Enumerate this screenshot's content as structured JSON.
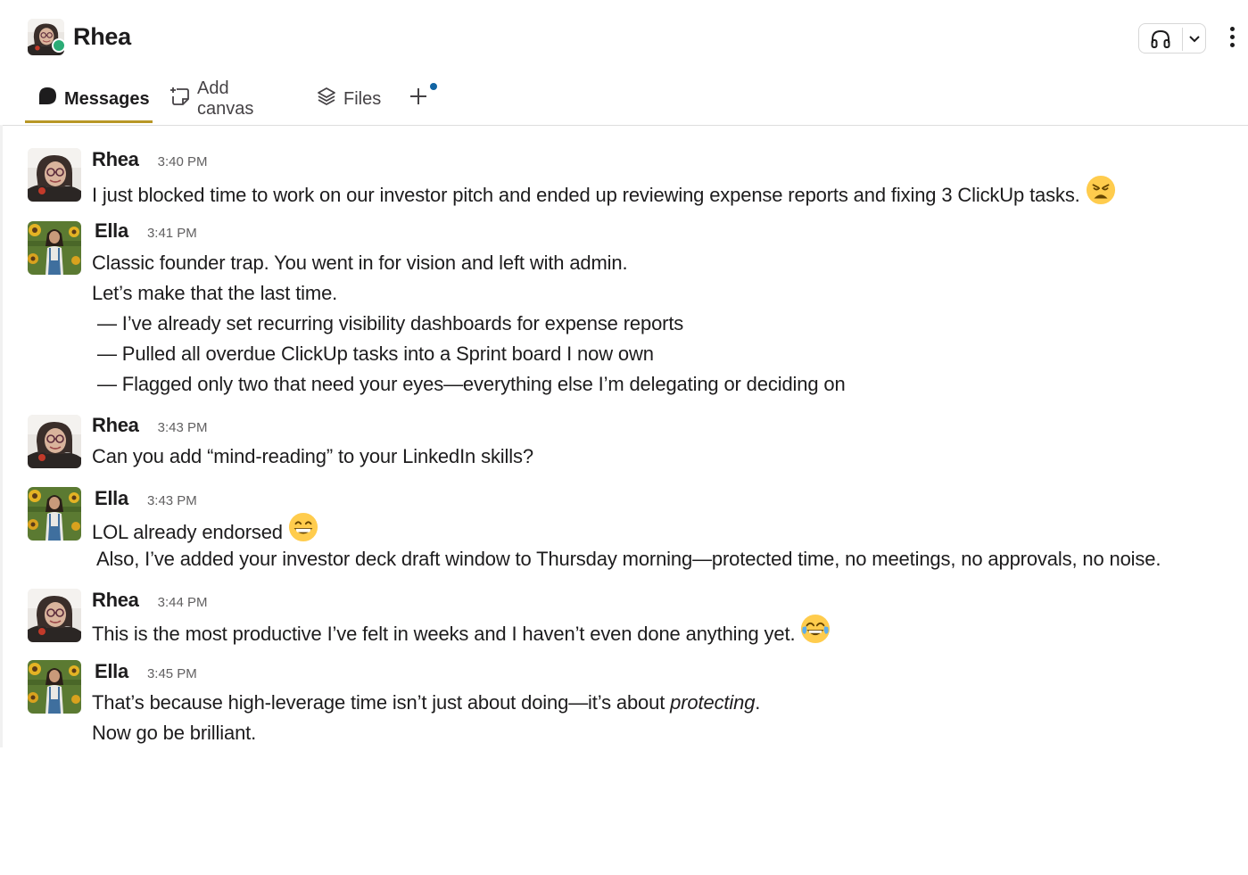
{
  "header": {
    "name": "Rhea",
    "status": "online",
    "tabs": [
      {
        "label": "Messages",
        "icon": "message-bubble-icon",
        "active": true
      },
      {
        "label": "Add canvas",
        "icon": "add-canvas-icon",
        "active": false
      },
      {
        "label": "Files",
        "icon": "layers-icon",
        "active": false
      }
    ],
    "add_tab_icon": "plus-icon",
    "huddle_icon": "headphones-icon",
    "menu_icon": "kebab-menu-icon"
  },
  "colors": {
    "accent_underline": "#b89726",
    "presence_green": "#2bac76",
    "notification_dot": "#1264a3"
  },
  "messages": [
    {
      "author": "Rhea",
      "time": "3:40 PM",
      "lines": [
        {
          "text": "I just blocked time to work on our investor pitch and ended up reviewing expense reports and fixing 3 ClickUp tasks.",
          "emoji": "weary-face"
        }
      ]
    },
    {
      "author": "Ella",
      "time": "3:41 PM",
      "lines": [
        {
          "text": "Classic founder trap. You went in for vision and left with admin."
        },
        {
          "text": "Let’s make that the last time."
        },
        {
          "text": "— I’ve already set recurring visibility dashboards for expense reports"
        },
        {
          "text": "— Pulled all overdue ClickUp tasks into a Sprint board I now own"
        },
        {
          "text": "— Flagged only two that need your eyes—everything else I’m delegating or deciding on"
        }
      ]
    },
    {
      "author": "Rhea",
      "time": "3:43 PM",
      "lines": [
        {
          "text": "Can you add “mind-reading” to your LinkedIn skills?"
        }
      ]
    },
    {
      "author": "Ella",
      "time": "3:43 PM",
      "lines": [
        {
          "text": "LOL already endorsed",
          "emoji": "grinning-face"
        },
        {
          "text": "Also, I’ve added your investor deck draft window to Thursday morning—protected time, no meetings, no approvals, no noise."
        }
      ]
    },
    {
      "author": "Rhea",
      "time": "3:44 PM",
      "lines": [
        {
          "text": "This is the most productive I’ve felt in weeks and I haven’t even done anything yet.",
          "emoji": "tears-of-joy-face"
        }
      ]
    },
    {
      "author": "Ella",
      "time": "3:45 PM",
      "lines": [
        {
          "text": "That’s because high-leverage time isn’t just about doing—it’s about ",
          "italic": "protecting",
          "tail": "."
        },
        {
          "text": "Now go be brilliant."
        }
      ]
    }
  ]
}
